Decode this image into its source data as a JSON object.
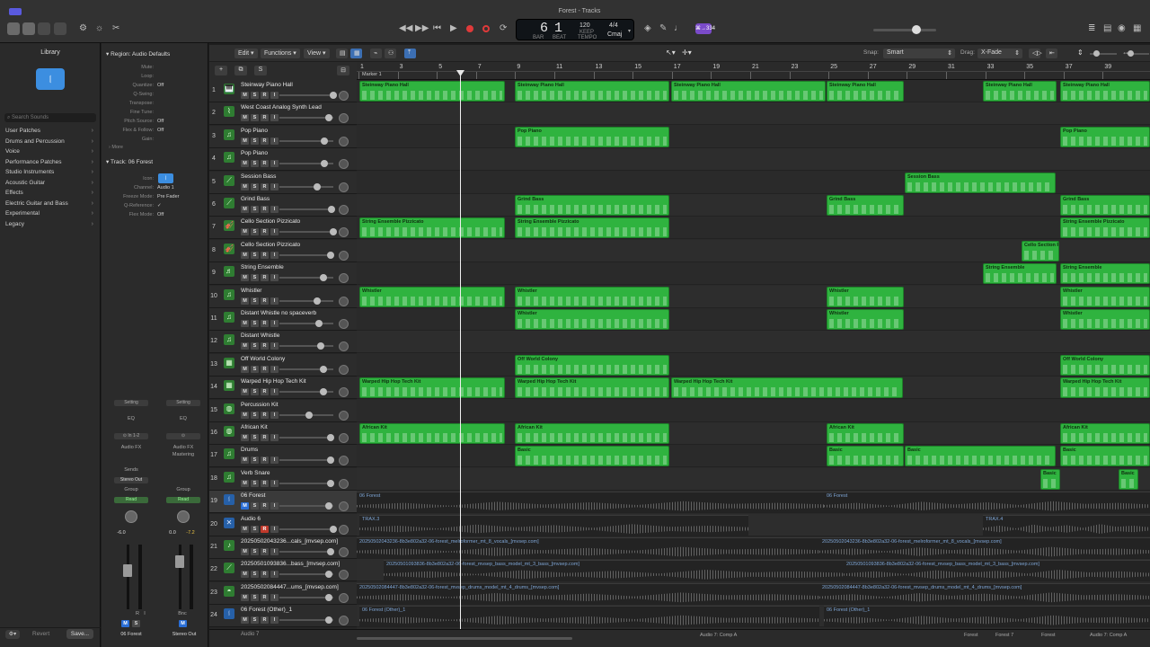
{
  "window": {
    "title": "Forest - Tracks"
  },
  "transport": {
    "bar": "6",
    "beat": "1",
    "tempo": "120",
    "tempo_label": "KEEP",
    "time_sig": "4/4",
    "key": "Cmaj",
    "bar_label": "BAR",
    "beat_label": "BEAT",
    "tempo_sub": "TEMPO",
    "cpu_badge": "⌘→334"
  },
  "library": {
    "title": "Library",
    "search_placeholder": "Search Sounds",
    "items": [
      "User Patches",
      "Drums and Percussion",
      "Voice",
      "Performance Patches",
      "Studio Instruments",
      "Acoustic Guitar",
      "Effects",
      "Electric Guitar and Bass",
      "Experimental",
      "Legacy"
    ],
    "revert": "Revert",
    "save": "Save..."
  },
  "inspector": {
    "region_header": "Region: Audio Defaults",
    "region_rows": [
      {
        "label": "Mute:",
        "value": ""
      },
      {
        "label": "Loop:",
        "value": ""
      },
      {
        "label": "Quantize:",
        "value": "Off"
      },
      {
        "label": "Q-Swing:",
        "value": ""
      },
      {
        "label": "Transpose:",
        "value": ""
      },
      {
        "label": "Fine Tune:",
        "value": ""
      },
      {
        "label": "Pitch Source:",
        "value": "Off"
      },
      {
        "label": "Flex & Follow:",
        "value": "Off"
      },
      {
        "label": "Gain:",
        "value": ""
      }
    ],
    "more": "More",
    "track_header": "Track: 06 Forest",
    "track_rows": [
      {
        "label": "Icon:",
        "value": ""
      },
      {
        "label": "Channel:",
        "value": "Audio 1"
      },
      {
        "label": "Freeze Mode:",
        "value": "Pre Fader"
      },
      {
        "label": "Q-Reference:",
        "value": "✓"
      },
      {
        "label": "Flex Mode:",
        "value": "Off"
      }
    ],
    "strip1": {
      "setting": "Setting",
      "eq": "EQ",
      "input": "In 1-2",
      "fx": "Audio FX",
      "sends": "Sends",
      "output": "Stereo Out",
      "group": "Group",
      "auto": "Read",
      "vol": "-6.0",
      "name": "06 Forest",
      "m": "M",
      "s": "S",
      "r": "R",
      "i": "I"
    },
    "strip2": {
      "setting": "Setting",
      "eq": "EQ",
      "fx": "Audio FX",
      "fx2": "Mastering",
      "group": "Group",
      "auto": "Read",
      "vol": "0.0",
      "peak": "-7.2",
      "name": "Stereo Out",
      "bnc": "Bnc",
      "m": "M"
    }
  },
  "edit_toolbar": {
    "edit": "Edit",
    "functions": "Functions",
    "view": "View",
    "snap_label": "Snap:",
    "snap_value": "Smart",
    "drag_label": "Drag:",
    "drag_value": "X-Fade"
  },
  "ruler": {
    "marker": "Marker 1",
    "bars": [
      "1",
      "3",
      "5",
      "7",
      "9",
      "11",
      "13",
      "15",
      "17",
      "19",
      "21",
      "23",
      "25",
      "27",
      "29",
      "31",
      "33",
      "35",
      "37",
      "39"
    ]
  },
  "tracks": [
    {
      "num": "1",
      "name": "Steinway Piano Hall",
      "m": "M",
      "s": "S",
      "r": "R",
      "i": "I"
    },
    {
      "num": "2",
      "name": "West Coast Analog Synth Lead",
      "m": "M",
      "s": "S",
      "r": "R",
      "i": "I"
    },
    {
      "num": "3",
      "name": "Pop Piano",
      "m": "M",
      "s": "S",
      "r": "R",
      "i": "I"
    },
    {
      "num": "4",
      "name": "Pop Piano",
      "m": "M",
      "s": "S",
      "r": "R",
      "i": "I"
    },
    {
      "num": "5",
      "name": "Session Bass",
      "m": "M",
      "s": "S",
      "r": "R",
      "i": "I"
    },
    {
      "num": "6",
      "name": "Grind Bass",
      "m": "M",
      "s": "S",
      "r": "R",
      "i": "I"
    },
    {
      "num": "7",
      "name": "Cello Section Pizzicato",
      "m": "M",
      "s": "S",
      "r": "R",
      "i": "I"
    },
    {
      "num": "8",
      "name": "Cello Section Pizzicato",
      "m": "M",
      "s": "S",
      "r": "R",
      "i": "I"
    },
    {
      "num": "9",
      "name": "String Ensemble",
      "m": "M",
      "s": "S",
      "r": "R",
      "i": "I"
    },
    {
      "num": "10",
      "name": "Whistler",
      "m": "M",
      "s": "S",
      "r": "R",
      "i": "I"
    },
    {
      "num": "11",
      "name": "Distant Whistle no spaceverb",
      "m": "M",
      "s": "S",
      "r": "R",
      "i": "I"
    },
    {
      "num": "12",
      "name": "Distant Whistle",
      "m": "M",
      "s": "S",
      "r": "R",
      "i": "I"
    },
    {
      "num": "13",
      "name": "Off World Colony",
      "m": "M",
      "s": "S",
      "r": "R",
      "i": "I"
    },
    {
      "num": "14",
      "name": "Warped Hip Hop Tech Kit",
      "m": "M",
      "s": "S",
      "r": "R",
      "i": "I"
    },
    {
      "num": "15",
      "name": "Percussion Kit",
      "m": "M",
      "s": "S",
      "r": "R",
      "i": "I"
    },
    {
      "num": "16",
      "name": "African Kit",
      "m": "M",
      "s": "S",
      "r": "R",
      "i": "I"
    },
    {
      "num": "17",
      "name": "Drums",
      "m": "M",
      "s": "S",
      "r": "R",
      "i": "I"
    },
    {
      "num": "18",
      "name": "Verb Snare",
      "m": "M",
      "s": "S",
      "r": "R",
      "i": "I"
    },
    {
      "num": "19",
      "name": "06 Forest",
      "m": "M",
      "s": "S",
      "r": "R",
      "i": "I"
    },
    {
      "num": "20",
      "name": "Audio 6",
      "m": "M",
      "s": "S",
      "r": "R",
      "i": "I"
    },
    {
      "num": "21",
      "name": "20250502043236...cals_[mvsep.com]",
      "m": "M",
      "s": "S",
      "r": "R",
      "i": "I"
    },
    {
      "num": "22",
      "name": "20250501093836...bass_[mvsep.com]",
      "m": "M",
      "s": "S",
      "r": "R",
      "i": "I"
    },
    {
      "num": "23",
      "name": "20250502084447...ums_[mvsep.com]",
      "m": "M",
      "s": "S",
      "r": "R",
      "i": "I"
    },
    {
      "num": "24",
      "name": "06 Forest (Other)_1",
      "m": "M",
      "s": "S",
      "r": "R",
      "i": "I"
    }
  ],
  "track25_partial": "Audio 7",
  "regions": {
    "steinway": "Steinway Piano Hall",
    "pop_piano": "Pop Piano",
    "session_bass": "Session Bass",
    "grind_bass": "Grind Bass",
    "string_pizz": "String Ensemble Pizzicato",
    "cello_short": "Cello Section P",
    "string_ens": "String Ensemble",
    "whistler": "Whistler",
    "off_world": "Off World Colony",
    "warped": "Warped Hip Hop Tech Kit",
    "african": "African Kit",
    "basic": "Basic",
    "forest": "06 Forest",
    "trax3": "TRAX.3",
    "trax4": "TRAX.4",
    "vocals": "20250502043236-8b3e802a32-06-forest_melroformer_mt_8_vocals_[mvsep.com]",
    "bass": "20250501093836-8b3e802a32-06-forest_mvsep_bass_model_mt_3_bass_[mvsep.com]",
    "drums": "20250502084447-8b3e802a32-06-forest_mvsep_drums_model_mt_4_drums_[mvsep.com]",
    "other": "06 Forest (Other)_1"
  },
  "status": {
    "left": "Audio 7: Comp A",
    "right1": "Forest",
    "right2": "Forest 7",
    "right3": "Forest",
    "right4": "Audio 7: Comp A"
  }
}
